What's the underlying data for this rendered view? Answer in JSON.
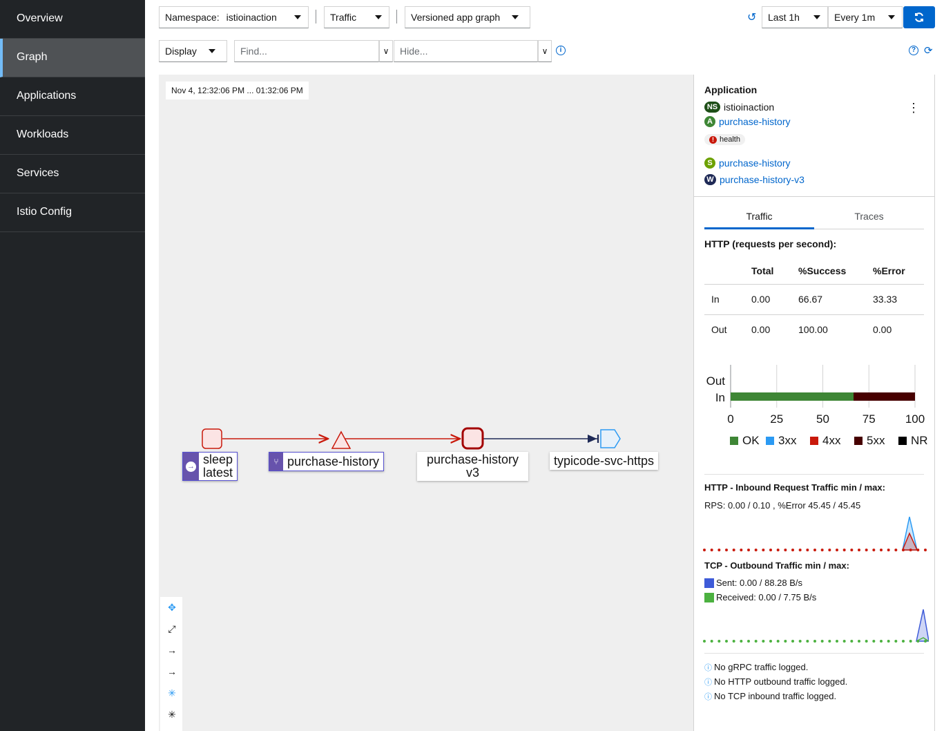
{
  "sidebar": {
    "items": [
      {
        "label": "Overview"
      },
      {
        "label": "Graph"
      },
      {
        "label": "Applications"
      },
      {
        "label": "Workloads"
      },
      {
        "label": "Services"
      },
      {
        "label": "Istio Config"
      }
    ]
  },
  "toolbar": {
    "namespace_label": "Namespace:",
    "namespace_value": "istioinaction",
    "traffic": "Traffic",
    "graph_type": "Versioned app graph",
    "time_range": "Last 1h",
    "refresh_interval": "Every 1m",
    "display": "Display",
    "find_placeholder": "Find...",
    "hide_placeholder": "Hide..."
  },
  "graph": {
    "time_window": "Nov 4, 12:32:06 PM ... 01:32:06 PM",
    "nodes": {
      "sleep": [
        "sleep",
        "latest"
      ],
      "purchase_history_app": "purchase-history",
      "purchase_history_v3": [
        "purchase-history",
        "v3"
      ],
      "typicode": "typicode-svc-https"
    }
  },
  "panel": {
    "title": "Application",
    "namespace_badge": "NS",
    "namespace": "istioinaction",
    "app_badge": "A",
    "app": "purchase-history",
    "health_label": "health",
    "service_badge": "S",
    "service": "purchase-history",
    "workload_badge": "W",
    "workload": "purchase-history-v3",
    "tabs": [
      "Traffic",
      "Traces"
    ],
    "http_title": "HTTP (requests per second):",
    "table": {
      "headers": [
        "",
        "Total",
        "%Success",
        "%Error"
      ],
      "rows": [
        [
          "In",
          "0.00",
          "66.67",
          "33.33"
        ],
        [
          "Out",
          "0.00",
          "100.00",
          "0.00"
        ]
      ]
    },
    "inbound_title": "HTTP - Inbound Request Traffic min / max:",
    "inbound_rps": "RPS: 0.00 / 0.10 , %Error 45.45 / 45.45",
    "tcp_title": "TCP - Outbound Traffic min / max:",
    "tcp_sent": "Sent: 0.00 / 88.28 B/s",
    "tcp_received": "Received: 0.00 / 7.75 B/s",
    "notes": [
      "No gRPC traffic logged.",
      "No HTTP outbound traffic logged.",
      "No TCP inbound traffic logged."
    ]
  },
  "colors": {
    "ok": "#3e8635",
    "x3": "#2b9af3",
    "x4": "#c9190b",
    "x5": "#470000",
    "nr": "#000000",
    "accent": "#0066cc"
  },
  "chart_data": {
    "type": "bar",
    "orientation": "horizontal",
    "stacked": true,
    "categories": [
      "Out",
      "In"
    ],
    "x_ticks": [
      0,
      25,
      50,
      75,
      100
    ],
    "xlim": [
      0,
      100
    ],
    "legend": [
      "OK",
      "3xx",
      "4xx",
      "5xx",
      "NR"
    ],
    "legend_placement": "bottom",
    "series": [
      {
        "name": "OK",
        "values": [
          0,
          66.67
        ]
      },
      {
        "name": "3xx",
        "values": [
          0,
          0
        ]
      },
      {
        "name": "4xx",
        "values": [
          0,
          0
        ]
      },
      {
        "name": "5xx",
        "values": [
          0,
          33.33
        ]
      },
      {
        "name": "NR",
        "values": [
          0,
          0
        ]
      }
    ]
  }
}
